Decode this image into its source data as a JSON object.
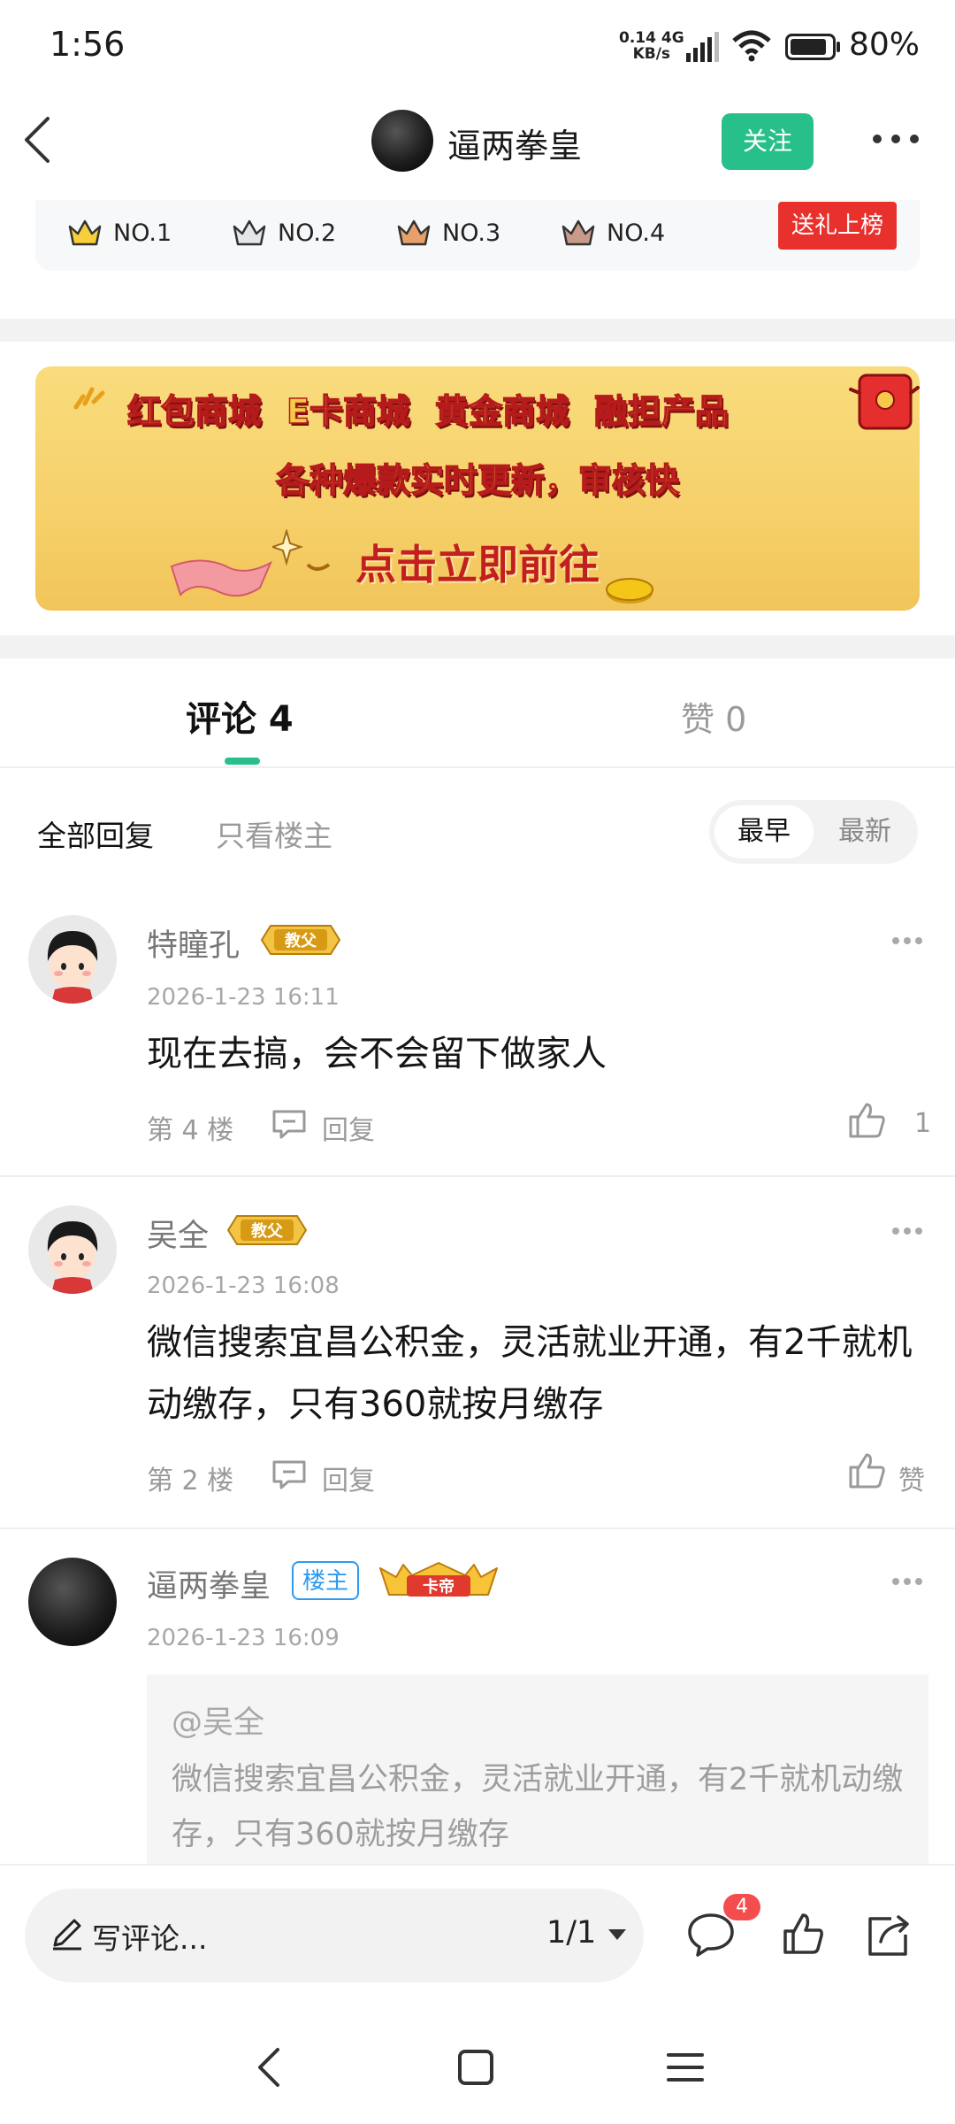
{
  "status_bar": {
    "time": "1:56",
    "net_speed_top": "0.14",
    "net_speed_bottom": "KB/s",
    "network_type": "4G",
    "battery": "80%"
  },
  "header": {
    "user_name": "逼两拳皇",
    "follow_label": "关注",
    "icons": [
      "back-icon",
      "more-icon"
    ]
  },
  "ranks": {
    "items": [
      "NO.1",
      "NO.2",
      "NO.3",
      "NO.4"
    ],
    "gift_label": "送礼上榜"
  },
  "banner": {
    "row1": [
      "红包商城",
      "E卡商城",
      "黄金商城",
      "融担产品"
    ],
    "row2": "各种爆款实时更新，审核快",
    "row3": "点击立即前往"
  },
  "tabs": {
    "comments_label": "评论 4",
    "likes_label": "赞 0"
  },
  "filters": {
    "all_label": "全部回复",
    "op_only_label": "只看楼主",
    "sort_oldest": "最早",
    "sort_newest": "最新"
  },
  "comments": [
    {
      "name": "特瞳孔",
      "badge": "教父",
      "date": "2026-1-23 16:11",
      "text": "现在去搞，会不会留下做家人",
      "floor": "第 4 楼",
      "reply_label": "回复",
      "likes": "1"
    },
    {
      "name": "吴全",
      "badge": "教父",
      "date": "2026-1-23 16:08",
      "text": "微信搜索宜昌公积金，灵活就业开通，有2千就机动缴存，只有360就按月缴存",
      "floor": "第 2 楼",
      "reply_label": "回复",
      "likes": "赞"
    },
    {
      "name": "逼两拳皇",
      "op_badge": "楼主",
      "badge": "卡帝",
      "date": "2026-1-23 16:09",
      "quote_at": "@吴全",
      "quote_text": "微信搜索宜昌公积金，灵活就业开通，有2千就机动缴存，只有360就按月缴存"
    }
  ],
  "bottom_bar": {
    "write_placeholder": "写评论...",
    "page_indicator": "1/1",
    "comment_count": "4"
  },
  "colors": {
    "accent_green": "#27c08a",
    "gift_red": "#e8312d",
    "badge_blue": "#2d9af0",
    "count_red": "#f44d4d"
  }
}
